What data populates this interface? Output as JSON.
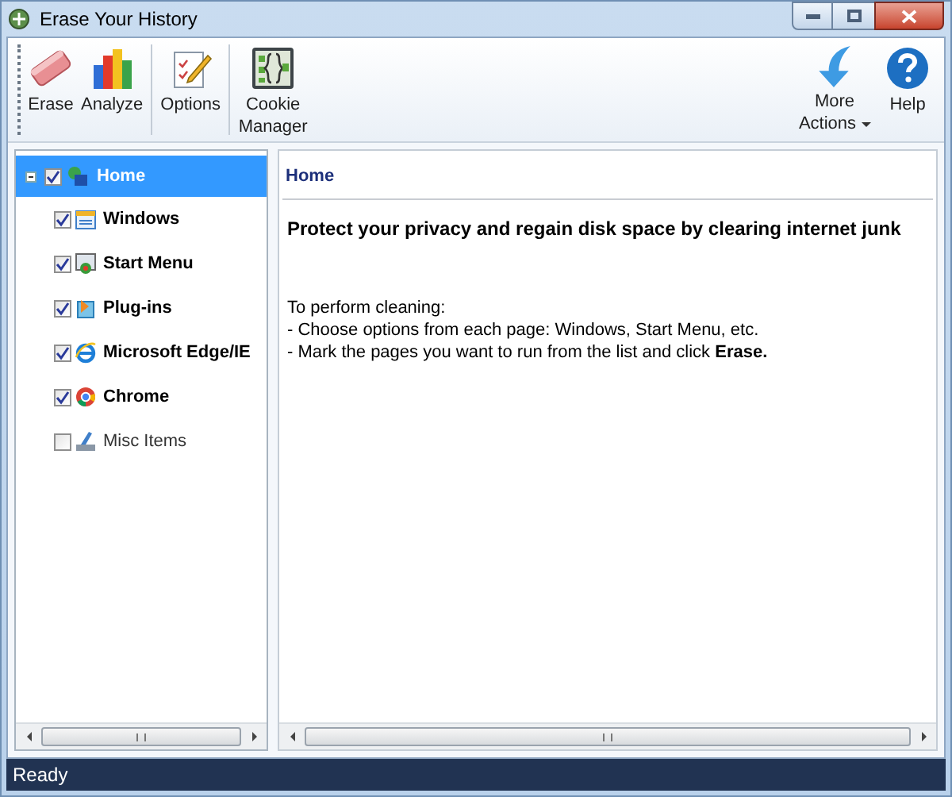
{
  "window": {
    "title": "Erase Your History"
  },
  "toolbar": [
    {
      "kind": "eraser",
      "label": "Erase"
    },
    {
      "kind": "chart",
      "label": "Analyze"
    },
    {
      "kind": "options",
      "label": "Options",
      "separator_before": true
    },
    {
      "kind": "cookie",
      "label": "Cookie Manager",
      "separator_before": true
    }
  ],
  "toolbar_right": [
    {
      "kind": "arrow",
      "label": "More Actions",
      "dropdown": true
    },
    {
      "kind": "help",
      "label": "Help",
      "dropdown": false
    }
  ],
  "tree": {
    "label": "Home",
    "checked": true,
    "selected": true,
    "expanded": true,
    "children": [
      {
        "label": "Windows",
        "checked": true,
        "selected": false,
        "kind": "window"
      },
      {
        "label": "Start Menu",
        "checked": true,
        "selected": false,
        "kind": "start"
      },
      {
        "label": "Plug-ins",
        "checked": true,
        "selected": false,
        "kind": "plugin"
      },
      {
        "label": "Microsoft Edge/IE",
        "checked": true,
        "selected": false,
        "kind": "ie"
      },
      {
        "label": "Chrome",
        "checked": true,
        "selected": false,
        "kind": "chrome"
      },
      {
        "label": "Misc Items",
        "checked": false,
        "selected": false,
        "kind": "misc"
      }
    ]
  },
  "content": {
    "heading": "Home",
    "headline": "Protect your privacy and regain disk space by clearing internet junk",
    "lines": [
      "To perform cleaning:",
      "- Choose options from each page: Windows, Start Menu, etc.",
      "- Mark the pages you want to run from the list and click **Erase.**"
    ]
  },
  "status_bar": {
    "text": "Ready"
  }
}
